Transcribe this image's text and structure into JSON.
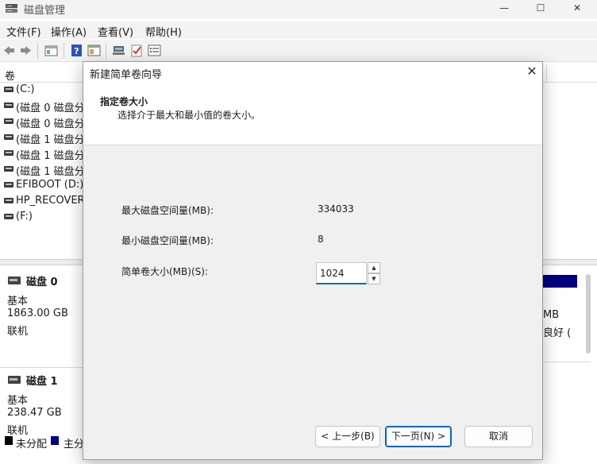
{
  "window": {
    "title": "磁盘管理",
    "controls": {
      "minimize": "—",
      "maximize": "☐",
      "close": "✕"
    }
  },
  "menu": {
    "items": [
      "文件(F)",
      "操作(A)",
      "查看(V)",
      "帮助(H)"
    ]
  },
  "toolbar": {
    "icons": [
      "back-icon",
      "forward-icon",
      "properties-icon",
      "help-icon",
      "console-icon",
      "connect-icon",
      "check-icon",
      "list-icon"
    ]
  },
  "volume_list": {
    "column_header": "卷",
    "items": [
      {
        "label": "(C:)"
      },
      {
        "label": "(磁盘 0 磁盘分"
      },
      {
        "label": "(磁盘 0 磁盘分"
      },
      {
        "label": "(磁盘 1 磁盘分"
      },
      {
        "label": "(磁盘 1 磁盘分"
      },
      {
        "label": "(磁盘 1 磁盘分"
      },
      {
        "label": "EFIBOOT (D:)"
      },
      {
        "label": "HP_RECOVER"
      },
      {
        "label": "(F:)"
      }
    ]
  },
  "disks": [
    {
      "name": "磁盘 0",
      "type": "基本",
      "size": "1863.00 GB",
      "status": "联机"
    },
    {
      "name": "磁盘 1",
      "type": "基本",
      "size": "238.47 GB",
      "status": "联机"
    }
  ],
  "legend": {
    "unallocated": "未分配",
    "primary": "主分",
    "unallocated_color": "#000000",
    "primary_color": "#000080"
  },
  "right_partial": {
    "line1": "MB",
    "line2": "良好 (",
    "bar_color": "#000080"
  },
  "dialog": {
    "title": "新建简单卷向导",
    "close": "✕",
    "header_title": "指定卷大小",
    "header_subtitle": "选择介于最大和最小值的卷大小。",
    "max_label": "最大磁盘空间量(MB):",
    "max_value": "334033",
    "min_label": "最小磁盘空间量(MB):",
    "min_value": "8",
    "size_label": "简单卷大小(MB)(S):",
    "size_value": "1024",
    "spin_up": "▲",
    "spin_down": "▼",
    "back_button": "< 上一步(B)",
    "next_button": "下一页(N) >",
    "cancel_button": "取消"
  }
}
